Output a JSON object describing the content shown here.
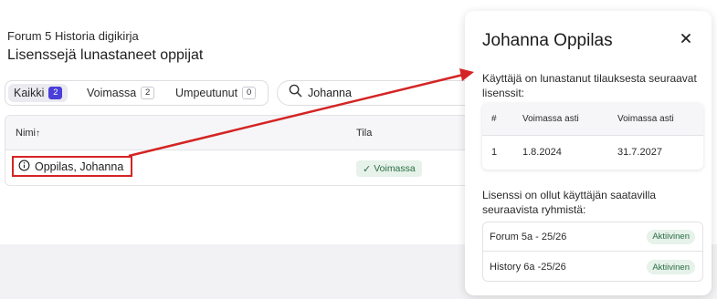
{
  "header": {
    "breadcrumb": "Forum 5 Historia digikirja",
    "title": "Lisenssejä lunastaneet oppijat"
  },
  "filters": [
    {
      "label": "Kaikki",
      "count": "2",
      "active": true
    },
    {
      "label": "Voimassa",
      "count": "2",
      "active": false
    },
    {
      "label": "Umpeutunut",
      "count": "0",
      "active": false
    }
  ],
  "search": {
    "value": "Johanna",
    "icon": "search-icon"
  },
  "table": {
    "columns": {
      "name": "Nimi",
      "status": "Tila"
    },
    "sort_icon": "↑",
    "rows": [
      {
        "name": "Oppilas, Johanna",
        "status": "Voimassa"
      }
    ]
  },
  "panel": {
    "title": "Johanna Oppilas",
    "intro": "Käyttäjä on lunastanut tilauksesta seuraavat lisenssit:",
    "license_table": {
      "columns": [
        "#",
        "Voimassa asti",
        "Voimassa asti"
      ],
      "rows": [
        [
          "1",
          "1.8.2024",
          "31.7.2027"
        ]
      ]
    },
    "groups_intro": "Lisenssi on ollut käyttäjän saatavilla seuraavista ryhmistä:",
    "groups": [
      {
        "name": "Forum 5a - 25/26",
        "status": "Aktiivinen"
      },
      {
        "name": "History 6a -25/26",
        "status": "Aktiivinen"
      }
    ]
  },
  "colors": {
    "accent": "#4a3fd8",
    "annotation": "#d42424",
    "success_bg": "#e6f2ea",
    "success_text": "#2c6d42"
  }
}
